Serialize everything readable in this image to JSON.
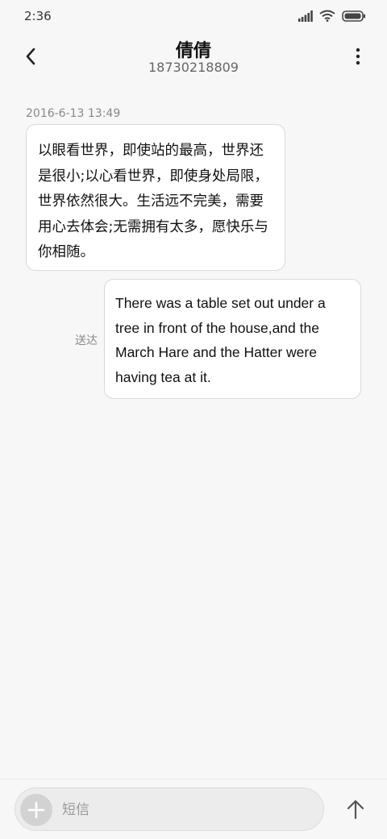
{
  "status_bar": {
    "time": "2:36",
    "icons": [
      "signal-icon",
      "wifi-icon",
      "battery-icon"
    ]
  },
  "header": {
    "back_icon": "chevron-left-icon",
    "contact_name": "倩倩",
    "contact_number": "18730218809",
    "more_icon": "more-vertical-icon"
  },
  "messages": {
    "timestamp": "2016-6-13 13:49",
    "incoming": {
      "text": "以眼看世界，即使站的最高，世界还是很小;以心看世界，即使身处局限，世界依然很大。生活远不完美，需要用心去体会;无需拥有太多，愿快乐与你相随。"
    },
    "outgoing": {
      "text": "There was a table set out under a tree in front of the house,and the March Hare and the Hatter were having tea at it.",
      "status": "送达"
    }
  },
  "composer": {
    "add_icon": "plus-icon",
    "placeholder": "短信",
    "value": "",
    "send_icon": "arrow-up-icon"
  },
  "colors": {
    "background": "#f7f7f7",
    "bubble": "#ffffff",
    "bubble_border": "#d9d9d9",
    "muted_text": "#888888"
  }
}
